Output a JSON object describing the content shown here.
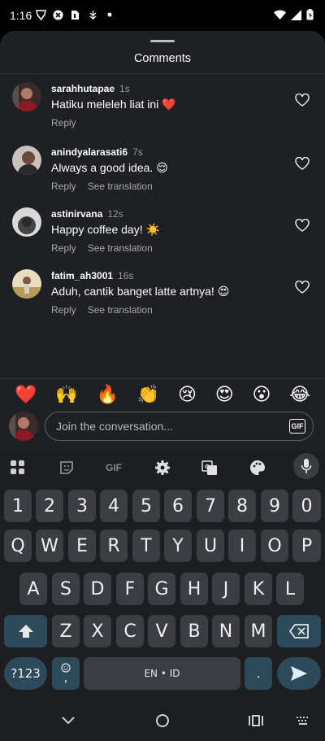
{
  "status_bar": {
    "time": "1:16"
  },
  "sheet": {
    "title": "Comments"
  },
  "comments": [
    {
      "user": "sarahhutapae",
      "time": "1s",
      "text": "Hatiku meleleh liat ini ❤️",
      "actions": [
        "Reply"
      ]
    },
    {
      "user": "anindyalarasati6",
      "time": "7s",
      "text": "Always a good idea. 😌",
      "actions": [
        "Reply",
        "See translation"
      ]
    },
    {
      "user": "astinirvana",
      "time": "12s",
      "text": "Happy coffee day! ☀️",
      "actions": [
        "Reply",
        "See translation"
      ]
    },
    {
      "user": "fatim_ah3001",
      "time": "16s",
      "text": "Aduh, cantik banget latte artnya! 😍",
      "actions": [
        "Reply",
        "See translation"
      ]
    }
  ],
  "reactions": [
    "❤️",
    "🙌",
    "🔥",
    "👏",
    "😢",
    "😍",
    "😮",
    "😂"
  ],
  "composer": {
    "placeholder": "Join the conversation...",
    "gif_label": "GIF"
  },
  "keyboard": {
    "toolbar": {
      "gif_label": "GIF"
    },
    "row_numbers": [
      "1",
      "2",
      "3",
      "4",
      "5",
      "6",
      "7",
      "8",
      "9",
      "0"
    ],
    "row_1": [
      "Q",
      "W",
      "E",
      "R",
      "T",
      "Y",
      "U",
      "I",
      "O",
      "P"
    ],
    "row_2": [
      "A",
      "S",
      "D",
      "F",
      "G",
      "H",
      "J",
      "K",
      "L"
    ],
    "row_3": [
      "Z",
      "X",
      "C",
      "V",
      "B",
      "N",
      "M"
    ],
    "symbols_label": "?123",
    "comma_label": ",",
    "space_label": "EN • ID",
    "period_label": "."
  },
  "colors": {
    "sheet_bg": "#1f2024",
    "keyboard_bg": "#1d1e22",
    "key_bg": "#3b3d42",
    "fn_key_bg": "#2c4a5a",
    "enter_bg": "#b6dcef"
  }
}
